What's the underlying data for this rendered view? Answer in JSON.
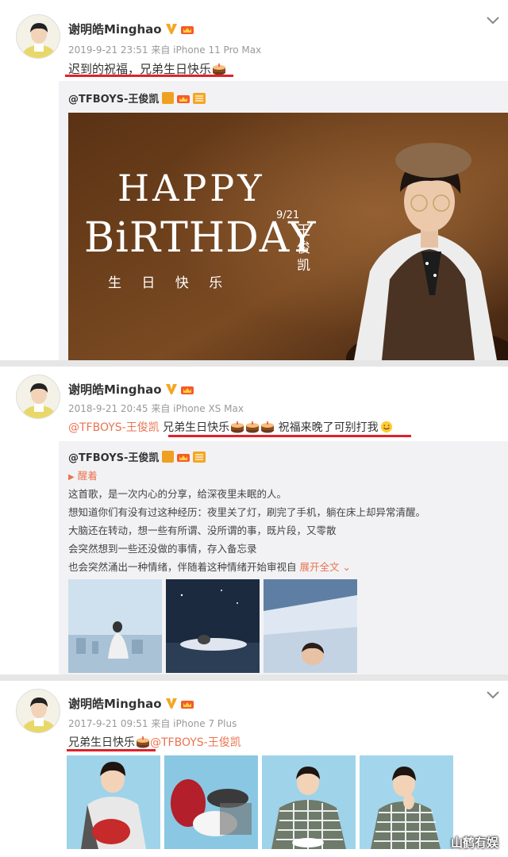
{
  "posts": [
    {
      "username": "谢明皓Minghao",
      "time": "2019-9-21 23:51",
      "source": "来自 iPhone 11 Pro Max",
      "text": "迟到的祝福，兄弟生日快乐",
      "repost": {
        "username": "@TFBOYS-王俊凯",
        "banner": {
          "line1": "HAPPY",
          "line2": "BiRTHDAY",
          "subtitle": "生 日 快 乐",
          "date": "9/21",
          "name_chars": [
            "王",
            "俊",
            "凯"
          ]
        }
      }
    },
    {
      "username": "谢明皓Minghao",
      "time": "2018-9-21 20:45",
      "source": "来自 iPhone XS Max",
      "mention": "@TFBOYS-王俊凯",
      "text": "兄弟生日快乐",
      "text_tail": "祝福来晚了可别打我",
      "repost": {
        "username": "@TFBOYS-王俊凯",
        "wake": "醒着",
        "lines": [
          "这首歌，是一次内心的分享，给深夜里未眠的人。",
          "想知道你们有没有过这种经历：夜里关了灯，刷完了手机，躺在床上却异常清醒。",
          "大脑还在转动，想一些有所谓、没所谓的事，既片段，又零散",
          "会突然想到一些还没做的事情，存入备忘录",
          "也会突然涌出一种情绪，伴随着这种情绪开始审视自"
        ],
        "expand": "展开全文"
      }
    },
    {
      "username": "谢明皓Minghao",
      "time": "2017-9-21 09:51",
      "source": "来自 iPhone 7 Plus",
      "text": "兄弟生日快乐",
      "mention": "@TFBOYS-王俊凯"
    }
  ],
  "watermark": "山鹤有娱",
  "colors": {
    "link": "#eb7350",
    "underline": "#e0212b",
    "repost_bg": "#f2f2f5"
  }
}
